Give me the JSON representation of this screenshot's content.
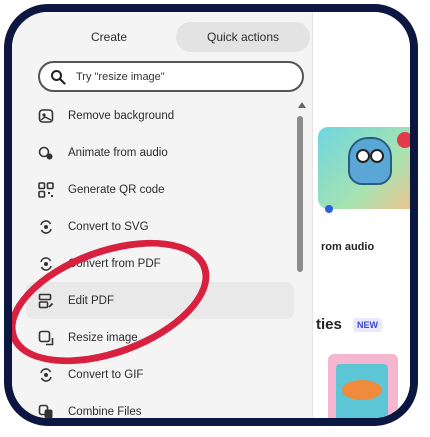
{
  "tabs": [
    {
      "label": "Create",
      "active": false
    },
    {
      "label": "Quick actions",
      "active": true
    }
  ],
  "search": {
    "placeholder": "Try \"resize image\""
  },
  "quick_actions": [
    {
      "label": "Remove background",
      "icon": "image-scissor-icon"
    },
    {
      "label": "Animate from audio",
      "icon": "audio-animate-icon"
    },
    {
      "label": "Generate QR code",
      "icon": "qr-code-icon"
    },
    {
      "label": "Convert to SVG",
      "icon": "convert-icon"
    },
    {
      "label": "Convert from PDF",
      "icon": "convert-icon"
    },
    {
      "label": "Edit PDF",
      "icon": "edit-pdf-icon"
    },
    {
      "label": "Resize image",
      "icon": "resize-icon"
    },
    {
      "label": "Convert to GIF",
      "icon": "convert-icon"
    },
    {
      "label": "Combine Files",
      "icon": "combine-icon"
    }
  ],
  "background": {
    "card_label": "rom audio",
    "section_title": "ties",
    "new_badge": "NEW"
  },
  "colors": {
    "frame": "#0b1740",
    "annotation": "#d8203f",
    "panel_bg": "#f4f4f4",
    "active_tab": "#e3e3e3"
  }
}
